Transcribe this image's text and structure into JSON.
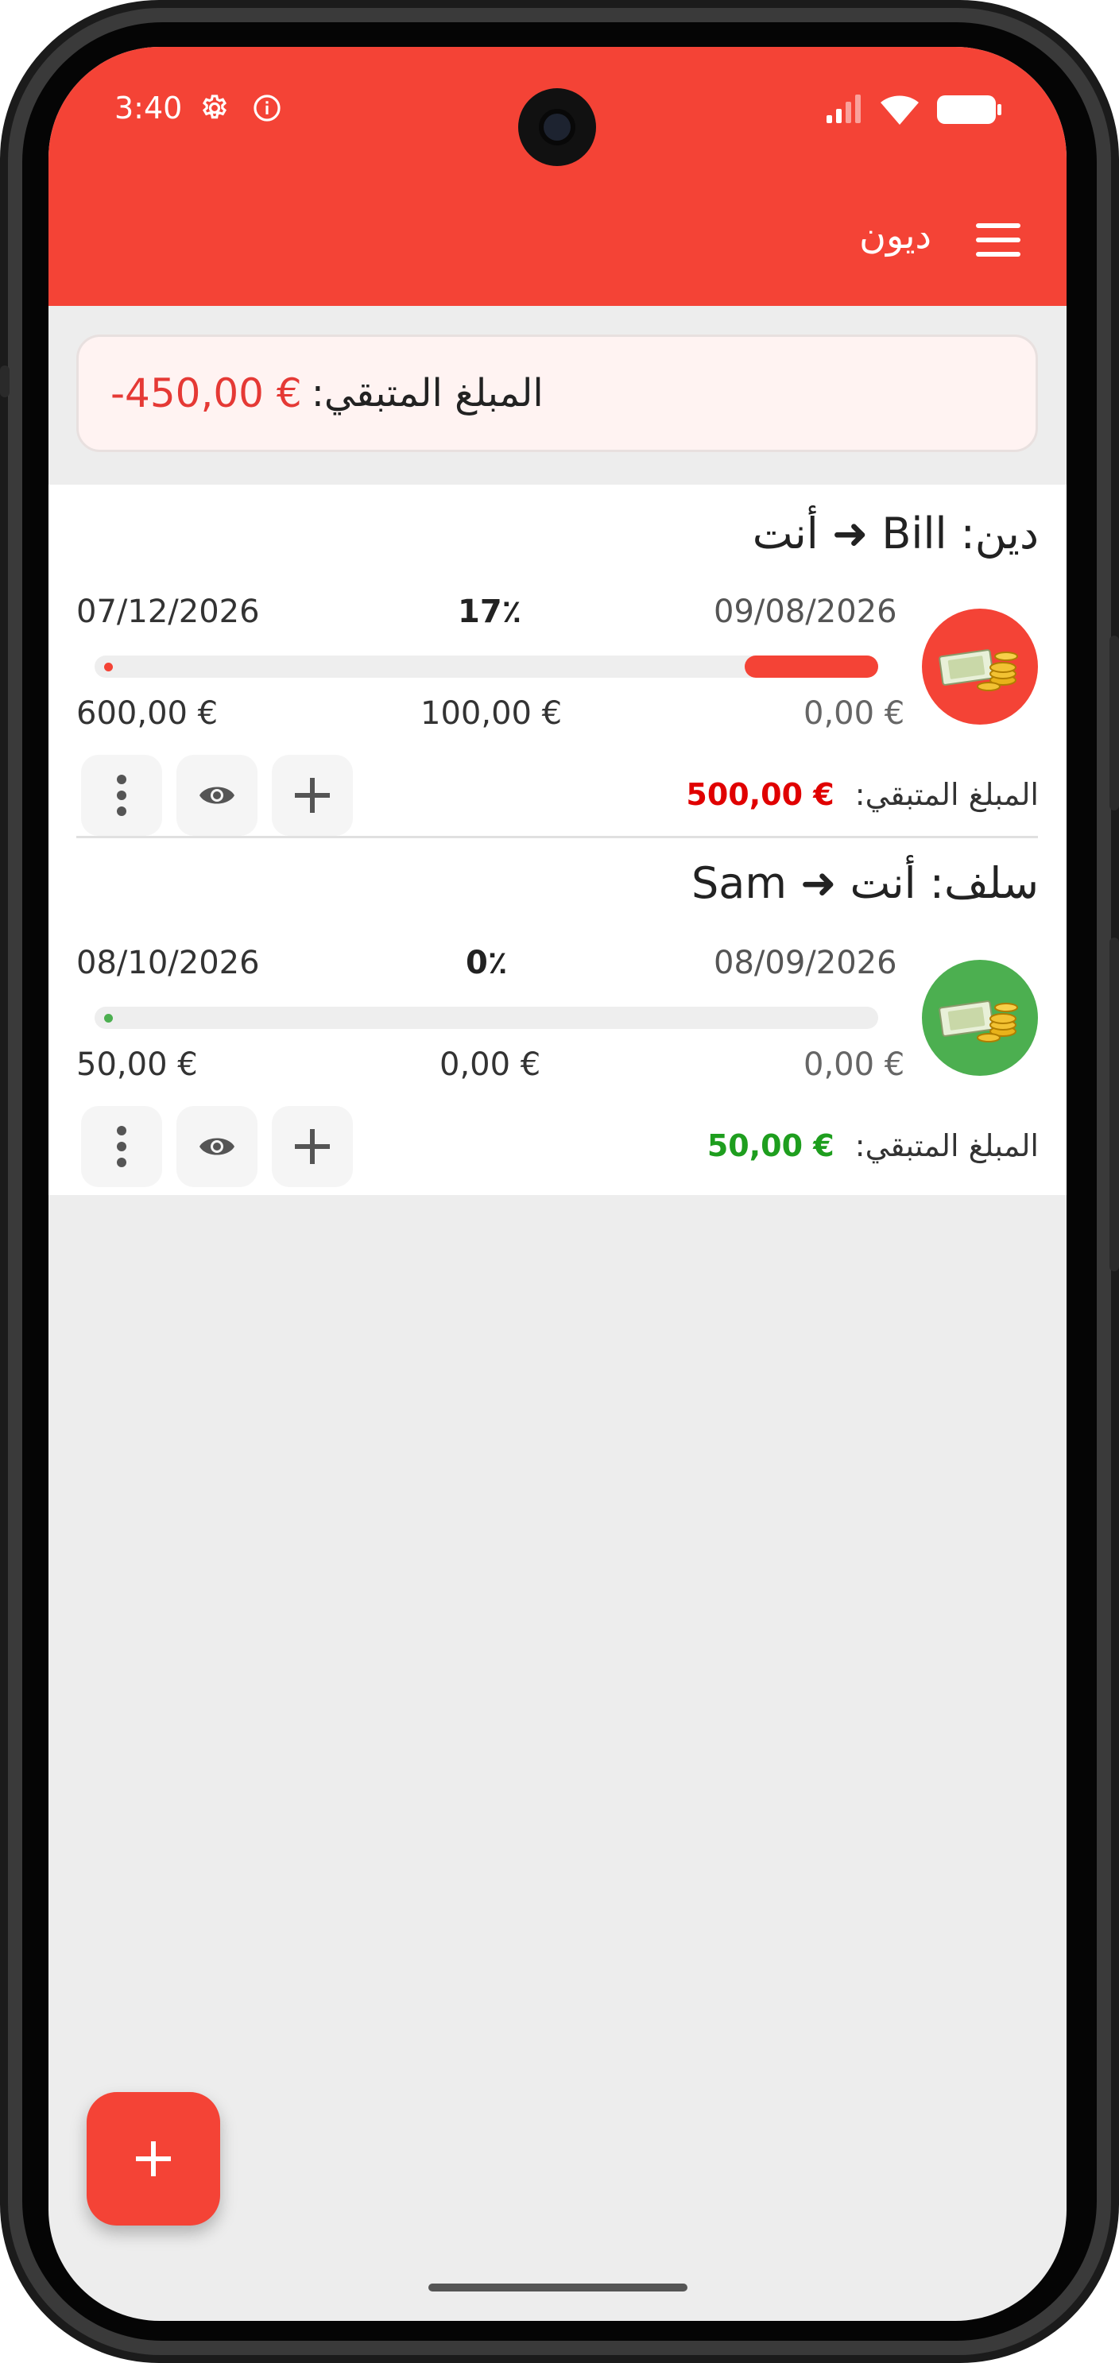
{
  "status_bar": {
    "time": "3:40"
  },
  "app_bar": {
    "title": "ديون"
  },
  "summary": {
    "label": "المبلغ المتبقي:",
    "amount": "-450,00 €"
  },
  "debts": [
    {
      "title": "دين: Bill ➜ أنت",
      "type_color": "#f44336",
      "start_date": "09/08/2026",
      "percent": "17٪",
      "end_date": "07/12/2026",
      "progress": 0.17,
      "amount_start": "0,00 €",
      "amount_paid": "100,00 €",
      "amount_total": "600,00 €",
      "remaining_label": "المبلغ المتبقي:",
      "remaining_amount": "500,00 €",
      "remaining_color": "#e00000"
    },
    {
      "title": "سلف: أنت ➜ Sam",
      "type_color": "#4caf50",
      "start_date": "08/09/2026",
      "percent": "0٪",
      "end_date": "08/10/2026",
      "progress": 0,
      "amount_start": "0,00 €",
      "amount_paid": "0,00 €",
      "amount_total": "50,00 €",
      "remaining_label": "المبلغ المتبقي:",
      "remaining_amount": "50,00 €",
      "remaining_color": "#1e9e1e"
    }
  ],
  "icons": {
    "menu": "hamburger-menu-icon",
    "settings": "gear-icon",
    "info": "info-icon",
    "signal": "signal-icon",
    "wifi": "wifi-icon",
    "battery": "battery-icon",
    "more": "more-vert-icon",
    "view": "eye-icon",
    "add": "plus-icon",
    "avatar": "money-icon"
  },
  "colors": {
    "primary": "#f44336",
    "negative": "#e53935",
    "positive": "#4caf50"
  }
}
